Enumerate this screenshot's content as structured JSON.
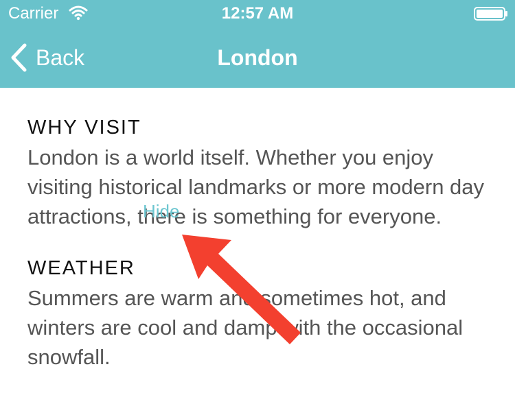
{
  "status_bar": {
    "carrier": "Carrier",
    "time": "12:57 AM",
    "wifi_icon": "wifi-icon",
    "battery_icon": "battery-icon"
  },
  "nav_bar": {
    "back_label": "Back",
    "back_icon": "chevron-left-icon",
    "title": "London"
  },
  "sections": [
    {
      "heading": "WHY VISIT",
      "body": "London is a world itself. Whether you enjoy visiting historical landmarks or more modern day attractions, there is something for everyone."
    },
    {
      "heading": "WEATHER",
      "body": "Summers are warm and sometimes hot, and winters are cool and damp with the occasional snowfall."
    }
  ],
  "hide_link": "Hide",
  "annotation": {
    "icon": "arrow-annotation",
    "color": "#f3402f"
  },
  "colors": {
    "header": "#69c2cb",
    "link": "#6cc6d0",
    "body_text": "#555555",
    "heading_text": "#111111"
  }
}
